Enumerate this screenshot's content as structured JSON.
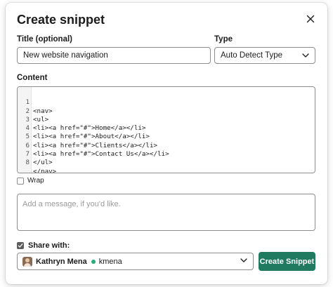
{
  "dialog": {
    "title": "Create snippet"
  },
  "fields": {
    "title_label": "Title (optional)",
    "title_value": "New website navigation",
    "type_label": "Type",
    "type_value": "Auto Detect Type",
    "content_label": "Content"
  },
  "code": {
    "lines": [
      {
        "n": "1",
        "text": "<nav>"
      },
      {
        "n": "2",
        "text": "<ul>"
      },
      {
        "n": "3",
        "text": "<li><a href=\"#\">Home</a></li>"
      },
      {
        "n": "4",
        "text": "<li><a href=\"#\">About</a></li>"
      },
      {
        "n": "5",
        "text": "<li><a href=\"#\">Clients</a></li>"
      },
      {
        "n": "6",
        "text": "<li><a href=\"#\">Contact Us</a></li>"
      },
      {
        "n": "7",
        "text": "</ul>"
      },
      {
        "n": "8",
        "text": "</nav>"
      }
    ]
  },
  "wrap": {
    "label": "Wrap",
    "checked": false
  },
  "message": {
    "placeholder": "Add a message, if you'd like."
  },
  "share": {
    "label": "Share with:",
    "checked": true,
    "user_name": "Kathryn Mena",
    "user_handle": "kmena",
    "status_color": "#2bac76"
  },
  "actions": {
    "create_label": "Create Snippet",
    "accent": "#1f7a5f"
  },
  "icons": {
    "close": "close-icon",
    "type_dropdown": "chevron-down-icon",
    "share_dropdown": "chevron-down-icon",
    "share_check": "check-icon"
  }
}
